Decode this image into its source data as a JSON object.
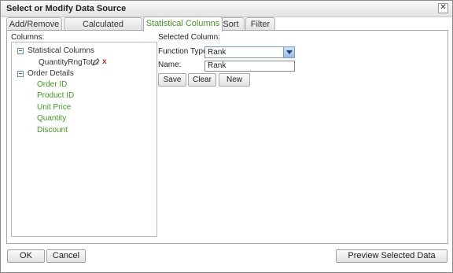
{
  "dialog": {
    "title": "Select or Modify Data Source",
    "close_glyph": "✕"
  },
  "tabs": [
    {
      "label": "Add/Remove",
      "active": false
    },
    {
      "label": "Calculated Columns",
      "active": false
    },
    {
      "label": "Statistical Columns",
      "active": true
    },
    {
      "label": "Sort",
      "active": false
    },
    {
      "label": "Filter",
      "active": false
    }
  ],
  "columns_panel": {
    "label": "Columns:",
    "tree": [
      {
        "label": "Statistical Columns",
        "expanded": true,
        "children": [
          {
            "label": "QuantityRngTotal",
            "icons": [
              "pencil-icon",
              "delete-icon"
            ]
          }
        ]
      },
      {
        "label": "Order Details",
        "expanded": true,
        "children": [
          {
            "label": "Order ID"
          },
          {
            "label": "Product ID"
          },
          {
            "label": "Unit Price"
          },
          {
            "label": "Quantity"
          },
          {
            "label": "Discount"
          }
        ]
      }
    ],
    "delete_glyph": "x"
  },
  "selected_column": {
    "label": "Selected Column:",
    "function_type_label": "Function Type:",
    "function_type_value": "Rank",
    "name_label": "Name:",
    "name_value": "Rank",
    "buttons": {
      "save": "Save",
      "clear": "Clear",
      "new": "New"
    }
  },
  "footer": {
    "ok": "OK",
    "cancel": "Cancel",
    "preview": "Preview Selected Data"
  },
  "colors": {
    "active_tab_text": "#3f9a1b",
    "column_item_text": "#3f9a1b",
    "delete_icon": "#cc2b1b"
  }
}
